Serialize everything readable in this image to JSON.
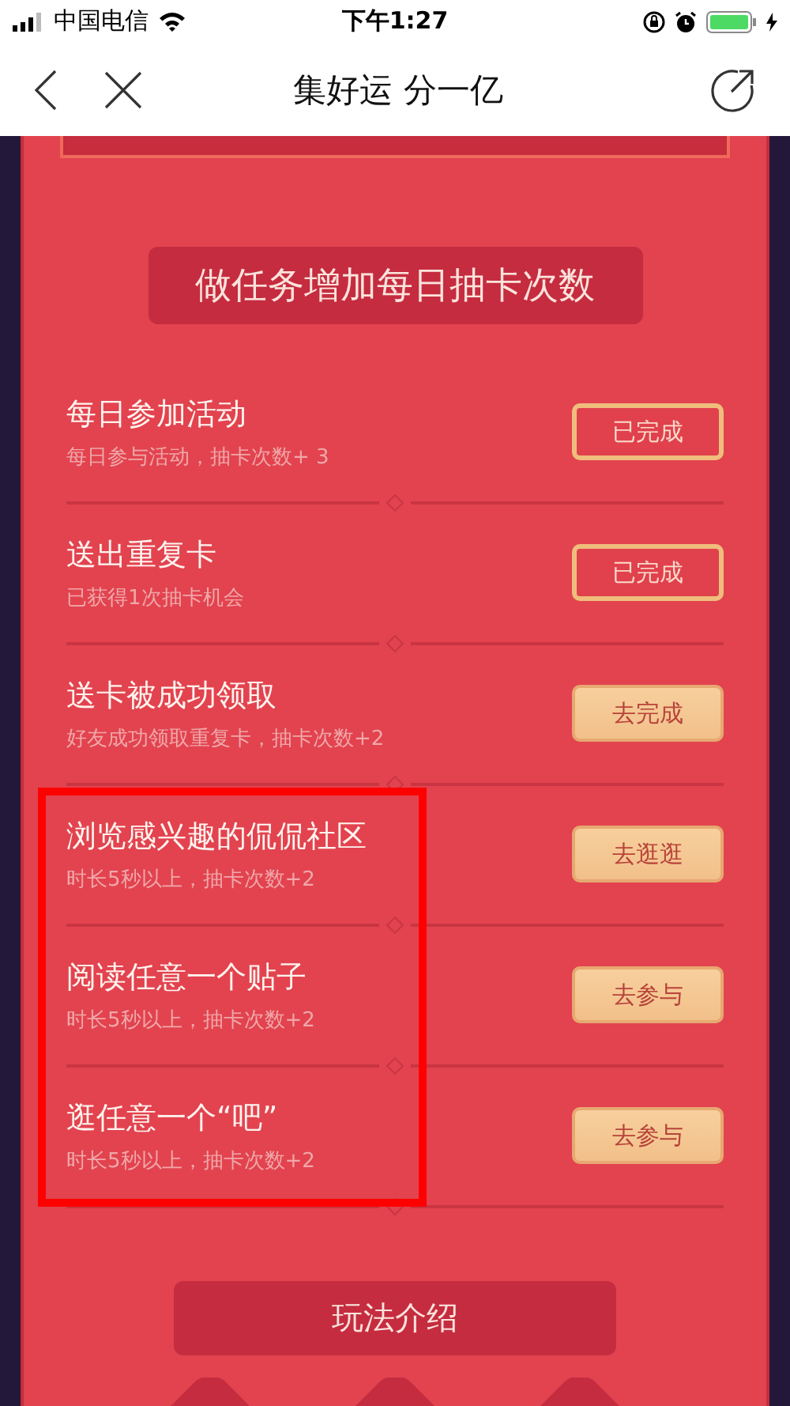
{
  "status_bar": {
    "carrier": "中国电信",
    "time": "下午1:27"
  },
  "nav": {
    "title": "集好运 分一亿"
  },
  "section_title": "做任务增加每日抽卡次数",
  "tasks": [
    {
      "title": "每日参加活动",
      "subtitle": "每日参与活动，抽卡次数+ 3",
      "button": "已完成",
      "done": true,
      "highlighted": false
    },
    {
      "title": "送出重复卡",
      "subtitle": "已获得1次抽卡机会",
      "button": "已完成",
      "done": true,
      "highlighted": false
    },
    {
      "title": "送卡被成功领取",
      "subtitle": "好友成功领取重复卡，抽卡次数+2",
      "button": "去完成",
      "done": false,
      "highlighted": false
    },
    {
      "title": "浏览感兴趣的侃侃社区",
      "subtitle": "时长5秒以上，抽卡次数+2",
      "button": "去逛逛",
      "done": false,
      "highlighted": true
    },
    {
      "title": "阅读任意一个贴子",
      "subtitle": "时长5秒以上，抽卡次数+2",
      "button": "去参与",
      "done": false,
      "highlighted": true
    },
    {
      "title": "逛任意一个“吧”",
      "subtitle": "时长5秒以上，抽卡次数+2",
      "button": "去参与",
      "done": false,
      "highlighted": true
    }
  ],
  "rules_title": "玩法介绍"
}
